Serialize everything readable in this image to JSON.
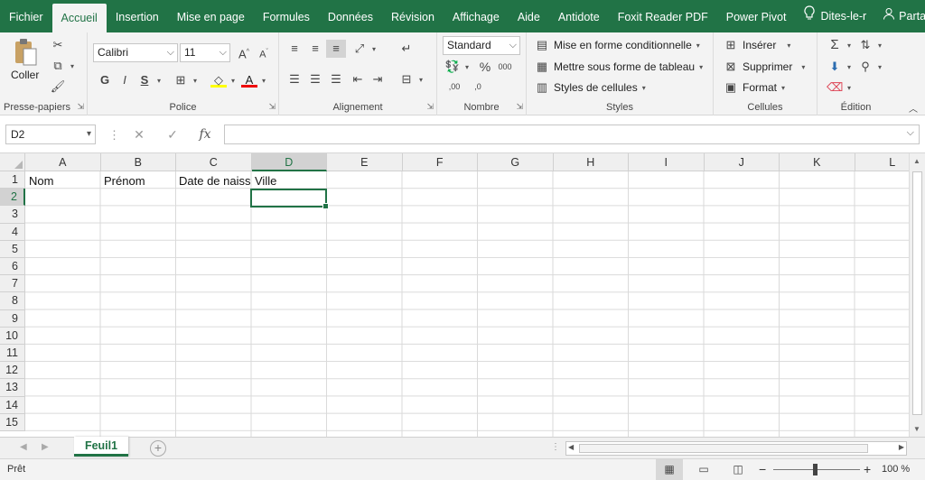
{
  "tabs": [
    {
      "label": "Fichier"
    },
    {
      "label": "Accueil"
    },
    {
      "label": "Insertion"
    },
    {
      "label": "Mise en page"
    },
    {
      "label": "Formules"
    },
    {
      "label": "Données"
    },
    {
      "label": "Révision"
    },
    {
      "label": "Affichage"
    },
    {
      "label": "Aide"
    },
    {
      "label": "Antidote"
    },
    {
      "label": "Foxit Reader PDF"
    },
    {
      "label": "Power Pivot"
    }
  ],
  "tell_me": "Dites-le-r",
  "share": "Partager",
  "clipboard": {
    "label": "Presse-papiers",
    "paste": "Coller"
  },
  "font": {
    "label": "Police",
    "name": "Calibri",
    "size": "11",
    "bold": "G",
    "italic": "I",
    "underline": "S",
    "grow": "A",
    "shrink": "A",
    "font_color_letter": "A"
  },
  "alignment": {
    "label": "Alignement"
  },
  "number": {
    "label": "Nombre",
    "format": "Standard",
    "percent": "%",
    "thousands": "000",
    "inc_dec": ",00",
    "dec_dec": ",0"
  },
  "styles": {
    "label": "Styles",
    "conditional": "Mise en forme conditionnelle",
    "table": "Mettre sous forme de tableau",
    "cell_styles": "Styles de cellules"
  },
  "cells": {
    "label": "Cellules",
    "insert": "Insérer",
    "delete": "Supprimer",
    "format": "Format"
  },
  "editing": {
    "label": "Édition"
  },
  "formula": {
    "namebox": "D2",
    "fx": "fx",
    "value": ""
  },
  "columns": [
    "A",
    "B",
    "C",
    "D",
    "E",
    "F",
    "G",
    "H",
    "I",
    "J",
    "K",
    "L"
  ],
  "rows": [
    "1",
    "2",
    "3",
    "4",
    "5",
    "6",
    "7",
    "8",
    "9",
    "10",
    "11",
    "12",
    "13",
    "14",
    "15"
  ],
  "cells_data": {
    "A1": "Nom",
    "B1": "Prénom",
    "C1": "Date de naissa",
    "D1": "Ville"
  },
  "sheet": {
    "name": "Feuil1"
  },
  "status": {
    "ready": "Prêt",
    "zoom": "100 %",
    "zoom_minus": "−",
    "zoom_plus": "+"
  },
  "colors": {
    "accent": "#217346",
    "ribbon_bg": "#f3f3f3"
  },
  "icons": [
    "cut-icon",
    "copy-icon",
    "format-painter-icon",
    "borders-icon",
    "fill-color-icon",
    "font-color-icon",
    "wrap-text-icon",
    "merge-icon",
    "autosum-icon",
    "fill-icon",
    "clear-icon",
    "sort-filter-icon",
    "find-icon",
    "lightbulb-icon",
    "person-icon"
  ]
}
